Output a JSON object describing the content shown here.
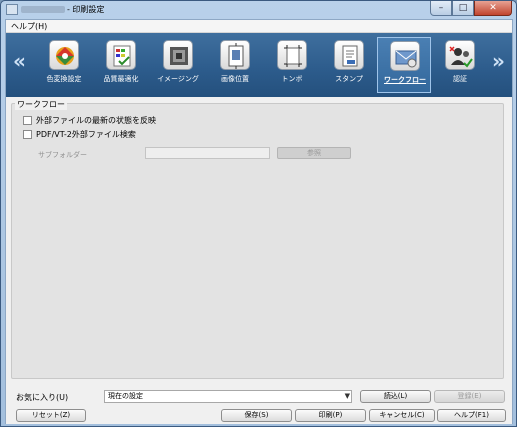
{
  "window": {
    "title": "- 印刷設定",
    "caption": {
      "minimize": "–",
      "maximize": "□",
      "close": "✕"
    }
  },
  "menubar": {
    "items": [
      {
        "label": "ヘルプ(H)"
      }
    ]
  },
  "toolbar": {
    "prev_arrow": "«",
    "next_arrow": "»",
    "items": [
      {
        "label": "色変換設定",
        "icon": "color-conversion-icon",
        "active": false
      },
      {
        "label": "品質最適化",
        "icon": "quality-optimize-icon",
        "active": false
      },
      {
        "label": "イメージング",
        "icon": "imaging-icon",
        "active": false
      },
      {
        "label": "画像位置",
        "icon": "image-position-icon",
        "active": false
      },
      {
        "label": "トンボ",
        "icon": "crop-marks-icon",
        "active": false
      },
      {
        "label": "スタンプ",
        "icon": "stamp-icon",
        "active": false
      },
      {
        "label": "ワークフロー",
        "icon": "workflow-icon",
        "active": true
      },
      {
        "label": "認証",
        "icon": "authentication-icon",
        "active": false
      }
    ]
  },
  "workflow": {
    "group_title": "ワークフロー",
    "option1": {
      "label": "外部ファイルの最新の状態を反映",
      "checked": false
    },
    "option2": {
      "label": "PDF/VT-2外部ファイル検索",
      "checked": false
    },
    "subfolder_label": "サブフォルダー",
    "subfolder_value": "",
    "browse_label": "参照"
  },
  "favorites": {
    "label": "お気に入り(U)",
    "selected": "現在の設定",
    "load_label": "読込(L)",
    "save_fav_label": "登録(E)"
  },
  "footer": {
    "reset_label": "リセット(Z)",
    "save_label": "保存(S)",
    "print_label": "印刷(P)",
    "cancel_label": "キャンセル(C)",
    "help_label": "ヘルプ(F1)"
  }
}
